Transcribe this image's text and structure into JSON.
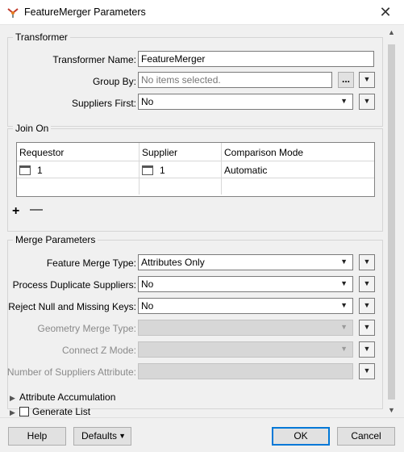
{
  "window": {
    "title": "FeatureMerger Parameters",
    "close_glyph": "✕"
  },
  "transformer": {
    "section_title": "Transformer",
    "name_label": "Transformer Name:",
    "name_value": "FeatureMerger",
    "group_by_label": "Group By:",
    "group_by_placeholder": "No items selected.",
    "group_by_button": "...",
    "suppliers_first_label": "Suppliers First:",
    "suppliers_first_value": "No"
  },
  "join_on": {
    "section_title": "Join On",
    "columns": [
      "Requestor",
      "Supplier",
      "Comparison Mode"
    ],
    "rows": [
      {
        "requestor": "1",
        "supplier": "1",
        "comparison_mode": "Automatic"
      }
    ],
    "add_glyph": "+",
    "remove_glyph": "—"
  },
  "merge_parameters": {
    "section_title": "Merge Parameters",
    "feature_merge_type_label": "Feature Merge Type:",
    "feature_merge_type_value": "Attributes Only",
    "process_duplicate_label": "Process Duplicate Suppliers:",
    "process_duplicate_value": "No",
    "reject_null_label": "Reject Null and Missing Keys:",
    "reject_null_value": "No",
    "geometry_merge_label": "Geometry Merge Type:",
    "connect_z_label": "Connect Z Mode:",
    "num_suppliers_label": "Number of Suppliers Attribute:"
  },
  "collapsed_sections": [
    "Attribute Accumulation",
    "Generate List"
  ],
  "footer": {
    "help": "Help",
    "defaults": "Defaults",
    "ok": "OK",
    "cancel": "Cancel"
  },
  "icons": {
    "app": "feature-merger-icon",
    "dropdown": "▼",
    "expand": "▶",
    "scroll_up": "▲",
    "scroll_down": "▼"
  },
  "colors": {
    "default_button_border": "#0078d7",
    "disabled_field": "#d7d7d7"
  }
}
